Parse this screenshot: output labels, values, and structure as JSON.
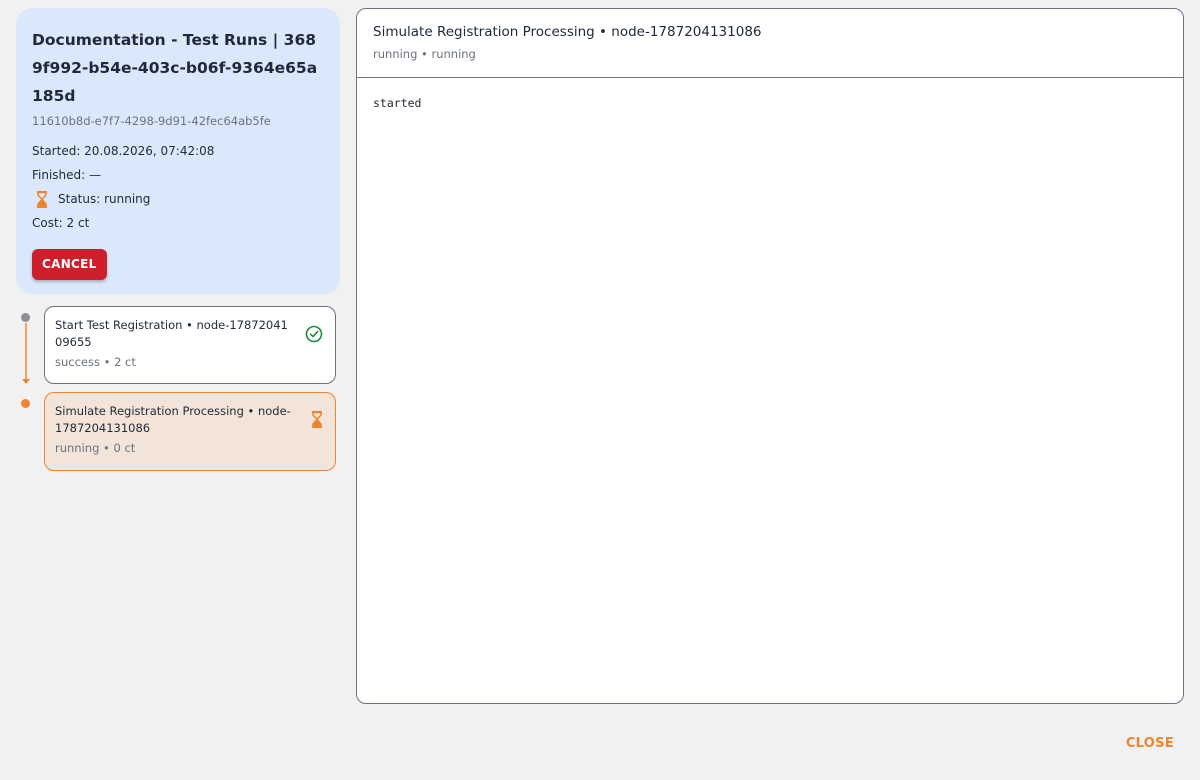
{
  "run": {
    "title": "Documentation - Test Runs | 3689f992-b54e-403c-b06f-9364e65a185d",
    "id": "11610b8d-e7f7-4298-9d91-42fec64ab5fe",
    "started": "Started: 20.08.2026, 07:42:08",
    "finished": "Finished: —",
    "status": "Status: running",
    "cost": "Cost: 2 ct",
    "cancel_label": "CANCEL"
  },
  "steps": [
    {
      "title": "Start Test Registration • node-1787204109655",
      "subtitle": "success • 2 ct",
      "status": "success",
      "icon": "check-circle-icon"
    },
    {
      "title": "Simulate Registration Processing • node-1787204131086",
      "subtitle": "running • 0 ct",
      "status": "running",
      "icon": "hourglass-icon"
    }
  ],
  "detail": {
    "title": "Simulate Registration Processing • node-1787204131086",
    "subtitle": "running • running",
    "log": "started"
  },
  "footer": {
    "close_label": "CLOSE"
  },
  "colors": {
    "accent": "#f0832f",
    "danger": "#d01f2c",
    "success": "#1e8a3c",
    "info_bg": "#dbe8fb"
  }
}
